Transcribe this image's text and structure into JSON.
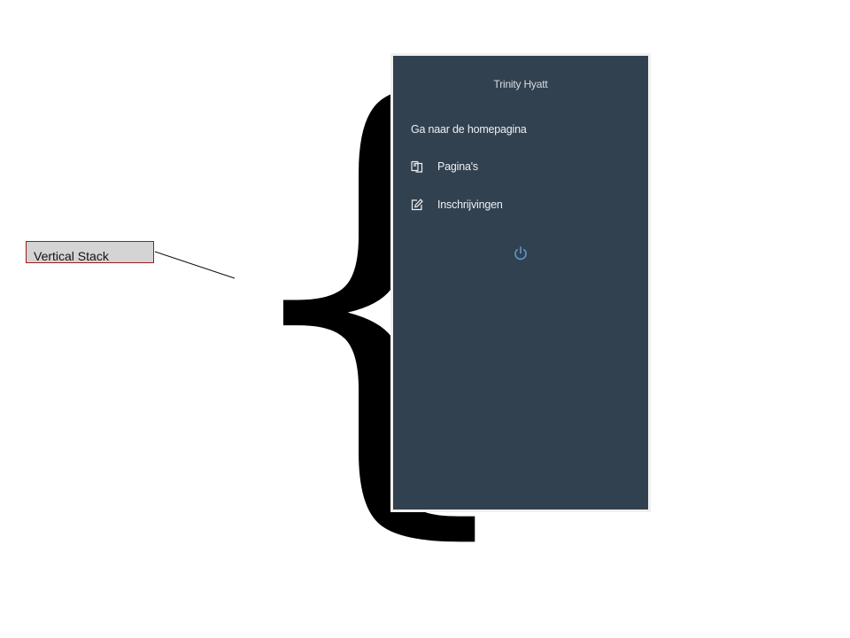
{
  "annotation": {
    "label": "Vertical Stack"
  },
  "sidebar": {
    "user_name": "Trinity Hyatt",
    "home_link": "Ga naar de homepagina",
    "items": [
      {
        "label": "Pagina's",
        "icon": "pages-icon"
      },
      {
        "label": "Inschrijvingen",
        "icon": "edit-icon"
      }
    ],
    "logout_icon": "power-icon"
  },
  "colors": {
    "sidebar_bg": "#32414f",
    "power_icon": "#5b8ec4",
    "annotation_border": "#9b1c1c",
    "annotation_bg": "#d4d4d4"
  }
}
